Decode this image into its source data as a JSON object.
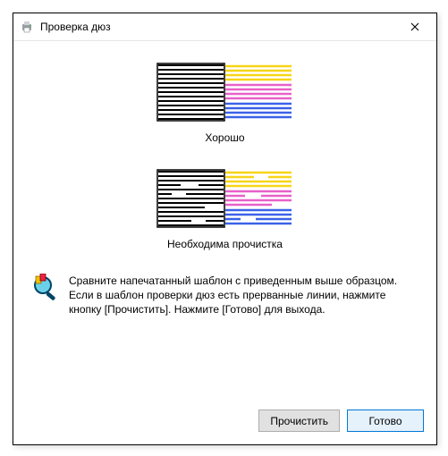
{
  "window": {
    "title": "Проверка дюз"
  },
  "samples": {
    "good_caption": "Хорошо",
    "bad_caption": "Необходима прочистка"
  },
  "info": {
    "text": "Сравните напечатанный шаблон с приведенным выше образцом. Если в шаблон проверки дюз есть прерванные линии, нажмите кнопку [Прочистить]. Нажмите [Готово] для выхода."
  },
  "buttons": {
    "clean": "Прочистить",
    "done": "Готово"
  },
  "colors": {
    "yellow": "#f7d516",
    "magenta": "#e861c9",
    "cyan": "#3a62e8"
  }
}
